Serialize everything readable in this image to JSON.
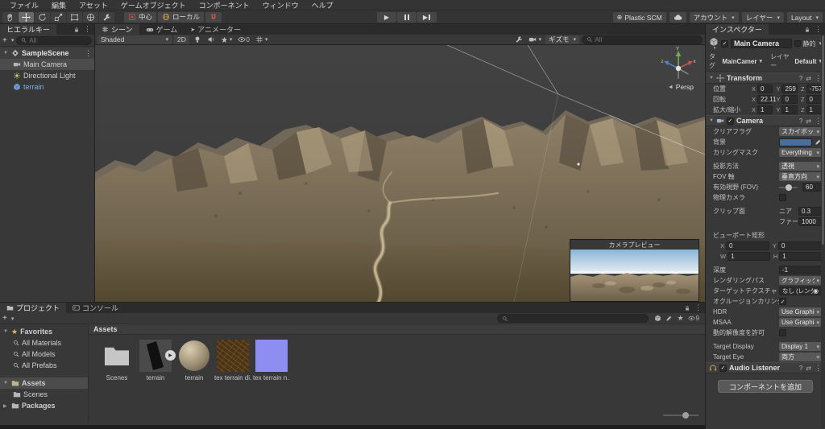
{
  "menu": {
    "items": [
      "ファイル",
      "編集",
      "アセット",
      "ゲームオブジェクト",
      "コンポーネント",
      "ウィンドウ",
      "ヘルプ"
    ]
  },
  "toolbar": {
    "pivot": "中心",
    "space": "ローカル",
    "plastic": "Plastic SCM",
    "account": "アカウント",
    "layers": "レイヤー",
    "layout": "Layout"
  },
  "hierarchy": {
    "tab": "ヒエラルキー",
    "search_placeholder": "All",
    "scene": "SampleScene",
    "items": [
      {
        "label": "Main Camera"
      },
      {
        "label": "Directional Light"
      },
      {
        "label": "terrain"
      }
    ]
  },
  "scene_view": {
    "tabs": [
      {
        "label": "シーン"
      },
      {
        "label": "ゲーム"
      },
      {
        "label": "アニメーター"
      }
    ],
    "shading": "Shaded",
    "mode_2d": "2D",
    "visibility_count": "0",
    "gizmos": "ギズモ",
    "search_placeholder": "All",
    "persp": "Persp",
    "preview_title": "カメラプレビュー"
  },
  "inspector": {
    "tab": "インスペクター",
    "name": "Main Camera",
    "static_label": "静的",
    "tag_label": "タグ",
    "tag_value": "MainCamer",
    "layer_label": "レイヤー",
    "layer_value": "Default",
    "transform": {
      "title": "Transform",
      "rows": [
        {
          "label": "位置",
          "x": "0",
          "y": "259",
          "z": "-757"
        },
        {
          "label": "回転",
          "x": "22.11",
          "y": "0",
          "z": "0"
        },
        {
          "label": "拡大/縮小",
          "x": "1",
          "y": "1",
          "z": "1"
        }
      ]
    },
    "camera": {
      "title": "Camera",
      "clear_flags_label": "クリアフラグ",
      "clear_flags": "スカイボックス",
      "background_label": "背景",
      "background_color": "#4a6e96",
      "culling_label": "カリングマスク",
      "culling": "Everything",
      "projection_label": "投影方法",
      "projection": "透視",
      "fov_axis_label": "FOV 軸",
      "fov_axis": "垂直方向",
      "fov_label": "有効視野 (FOV)",
      "fov": "60",
      "physical_label": "物理カメラ",
      "clip_label": "クリップ面",
      "near_label": "ニア",
      "near": "0.3",
      "far_label": "ファー",
      "far": "1000",
      "viewport_label": "ビューポート矩形",
      "vx_label": "X",
      "vx": "0",
      "vy_label": "Y",
      "vy": "0",
      "vw_label": "W",
      "vw": "1",
      "vh_label": "H",
      "vh": "1",
      "depth_label": "深度",
      "depth": "-1",
      "rendering_path_label": "レンダリングパス",
      "rendering_path": "グラフィックス設定を使用",
      "target_texture_label": "ターゲットテクスチャ",
      "target_texture": "なし (レンダーテクスチャ)",
      "occlusion_label": "オクルージョンカリング",
      "hdr_label": "HDR",
      "hdr": "Use Graphics Settin",
      "msaa_label": "MSAA",
      "msaa": "Use Graphics Settin",
      "dynamic_res_label": "動的解像度を許可",
      "target_display_label": "Target Display",
      "target_display": "Display 1",
      "target_eye_label": "Target Eye",
      "target_eye": "両方"
    },
    "audio_listener": "Audio Listener",
    "add_component": "コンポーネントを追加"
  },
  "project": {
    "tab": "プロジェクト",
    "console_tab": "コンソール",
    "favorites": "Favorites",
    "fav_items": [
      {
        "label": "All Materials"
      },
      {
        "label": "All Models"
      },
      {
        "label": "All Prefabs"
      }
    ],
    "assets": "Assets",
    "scenes": "Scenes",
    "packages": "Packages",
    "header": "Assets",
    "hidden_count": "9",
    "tiles": [
      {
        "label": "Scenes"
      },
      {
        "label": "terrain"
      },
      {
        "label": "terrain"
      },
      {
        "label": "tex terrain di…"
      },
      {
        "label": "tex terrain n…"
      }
    ]
  }
}
